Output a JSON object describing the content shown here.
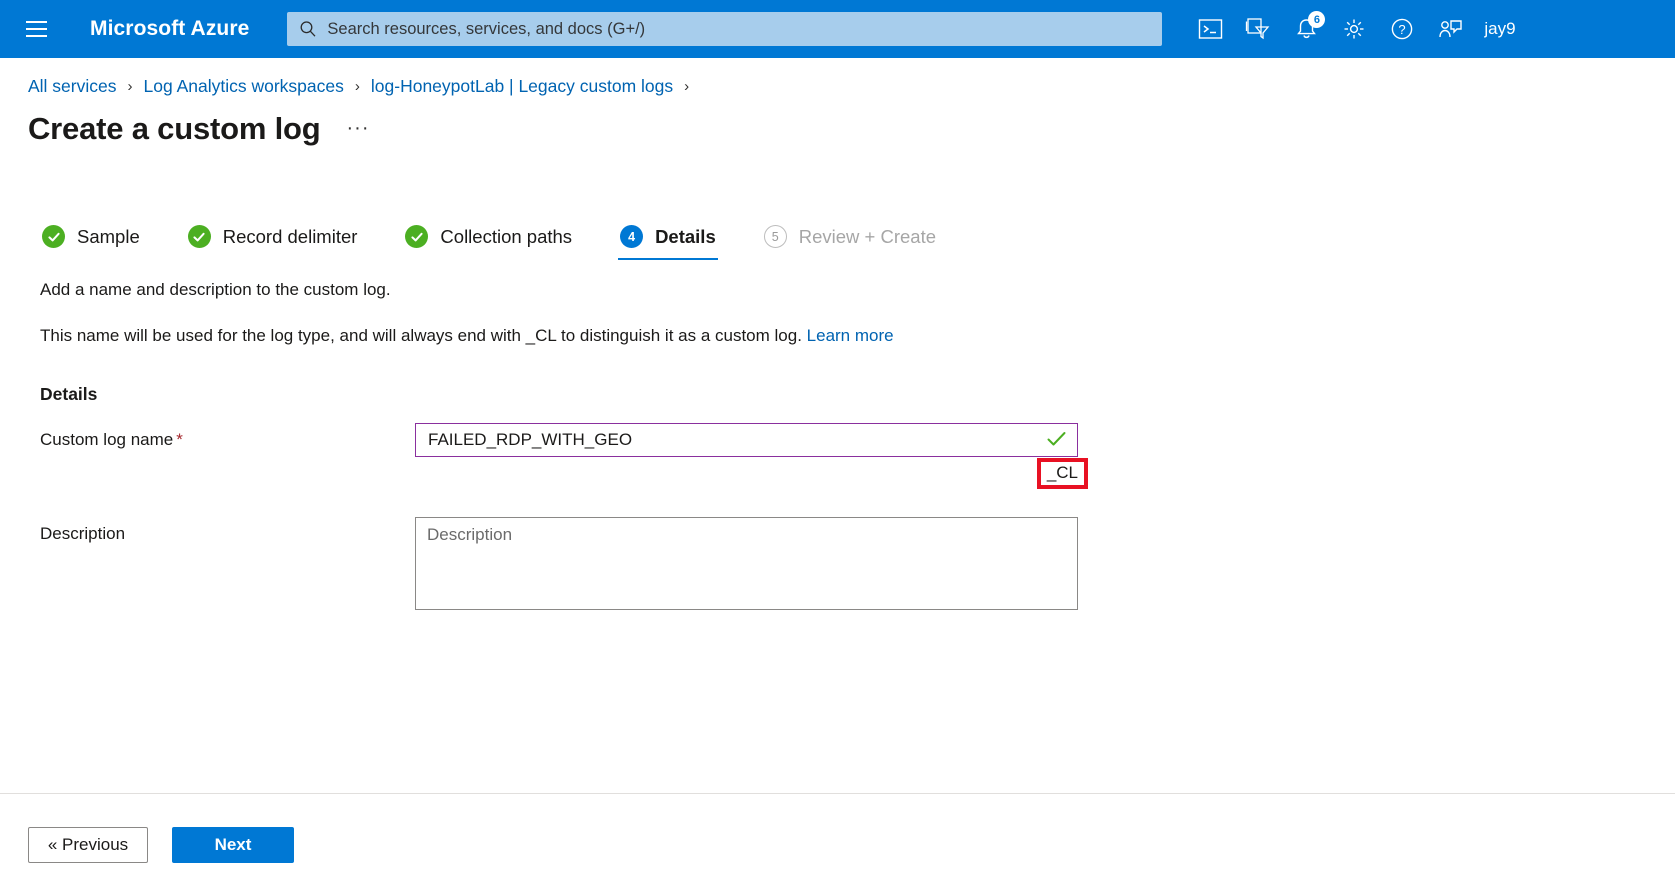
{
  "topbar": {
    "menu_icon": "hamburger-menu-icon",
    "brand": "Microsoft Azure",
    "search": {
      "placeholder": "Search resources, services, and docs (G+/)",
      "icon": "search-icon"
    },
    "icons": [
      {
        "name": "cloud-shell-icon",
        "label": "Cloud Shell"
      },
      {
        "name": "directories-filter-icon",
        "label": "Directories + subscriptions"
      },
      {
        "name": "notifications-bell-icon",
        "label": "Notifications",
        "badge": "6"
      },
      {
        "name": "settings-gear-icon",
        "label": "Settings"
      },
      {
        "name": "help-question-icon",
        "label": "Help"
      },
      {
        "name": "feedback-icon",
        "label": "Feedback"
      }
    ],
    "user": "jay9"
  },
  "breadcrumb": [
    "All services",
    "Log Analytics workspaces",
    "log-HoneypotLab | Legacy custom logs"
  ],
  "page": {
    "title": "Create a custom log",
    "more_menu": "···"
  },
  "wizard": {
    "steps": [
      {
        "num": "1",
        "label": "Sample",
        "state": "done"
      },
      {
        "num": "2",
        "label": "Record delimiter",
        "state": "done"
      },
      {
        "num": "3",
        "label": "Collection paths",
        "state": "done"
      },
      {
        "num": "4",
        "label": "Details",
        "state": "active"
      },
      {
        "num": "5",
        "label": "Review + Create",
        "state": "pending"
      }
    ]
  },
  "intro": {
    "line1": "Add a name and description to the custom log.",
    "line2": "This name will be used for the log type, and will always end with _CL to distinguish it as a custom log.",
    "link": "Learn more"
  },
  "form": {
    "section_title": "Details",
    "custom_log_name": {
      "label": "Custom log name",
      "required_marker": "*",
      "value": "FAILED_RDP_WITH_GEO",
      "suffix": "_CL",
      "valid_icon": "green-check-icon"
    },
    "description": {
      "label": "Description",
      "value": "",
      "placeholder": "Description"
    }
  },
  "footer": {
    "previous": "« Previous",
    "next": "Next"
  },
  "colors": {
    "azure_blue": "#0078d4",
    "link_blue": "#0063b1",
    "success_green": "#4caf22",
    "highlight_red": "#e81123",
    "input_focus_purple": "#8a2f9e",
    "required_red": "#a4262c"
  }
}
